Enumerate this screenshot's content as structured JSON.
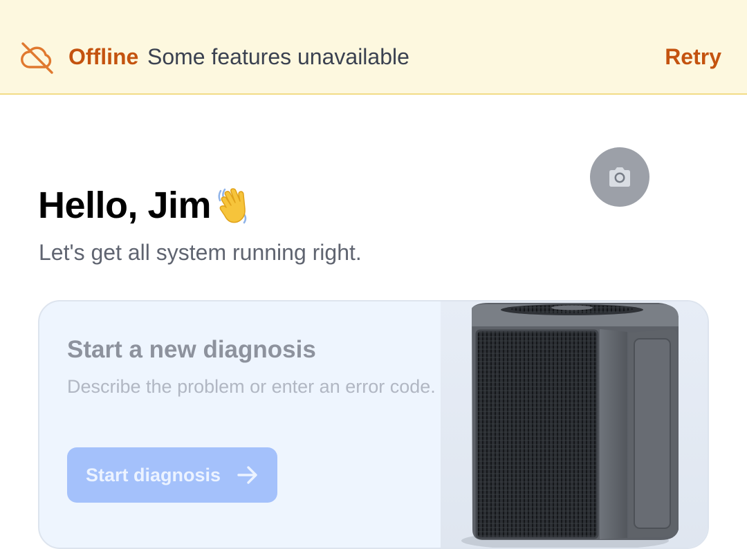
{
  "banner": {
    "status": "Offline",
    "message": "Some features unavailable",
    "retry_label": "Retry",
    "icon": "cloud-off-icon",
    "accent_color": "#c4530f",
    "background_color": "#fdf8df"
  },
  "greeting": {
    "title": "Hello, Jim",
    "emoji_icon": "waving-hand-icon",
    "subtitle": "Let's get all system running right."
  },
  "diagnosis_card": {
    "title": "Start a new diagnosis",
    "description": "Describe the problem or enter an error code.",
    "button_label": "Start diagnosis",
    "button_icon": "arrow-right-icon",
    "image": "air-conditioner-unit",
    "camera_icon": "camera-icon",
    "button_color": "#a4c1fb",
    "card_color": "#eef5fe"
  }
}
